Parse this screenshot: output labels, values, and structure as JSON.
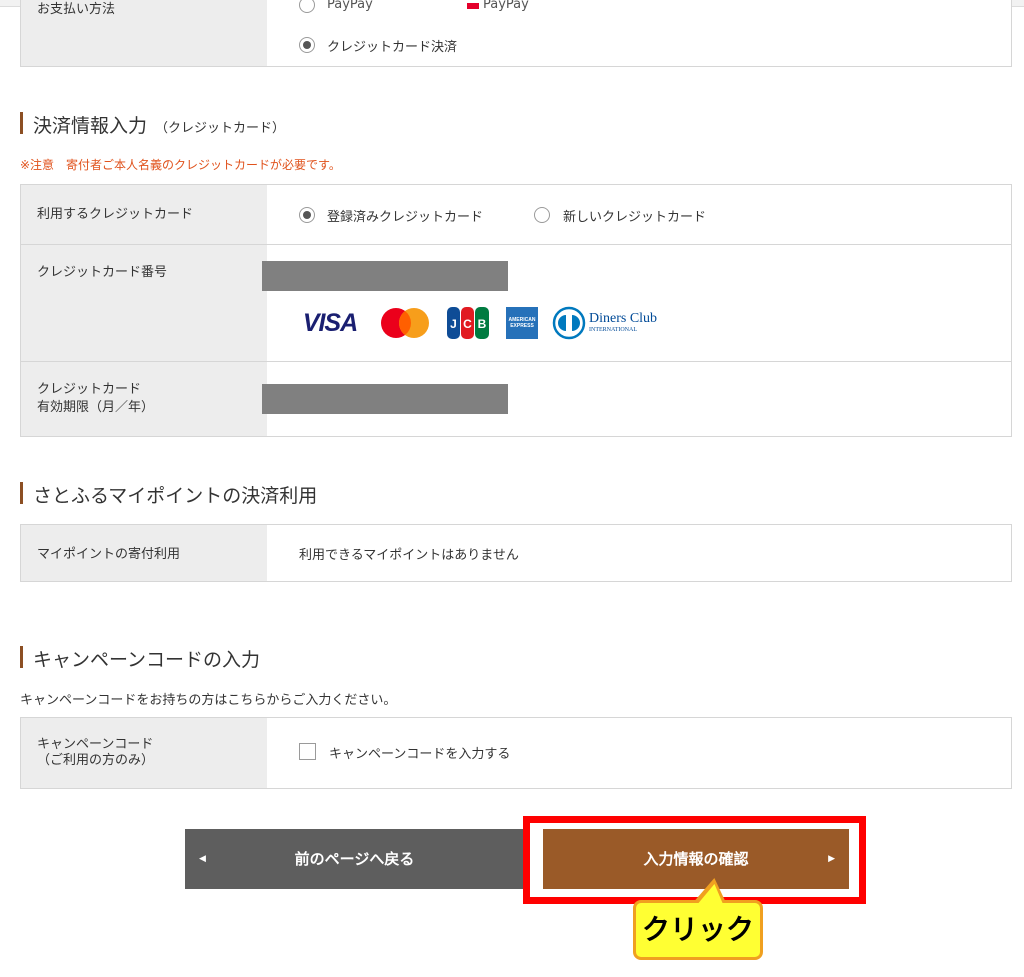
{
  "payment_method": {
    "label": "お支払い方法",
    "cut_options": [
      "PayPay",
      "PayPay"
    ],
    "credit_option": "クレジットカード決済"
  },
  "card_section": {
    "title": "決済情報入力",
    "subtitle": "（クレジットカード）",
    "notice": "※注意　寄付者ご本人名義のクレジットカードが必要です。",
    "use_card_label": "利用するクレジットカード",
    "option_registered": "登録済みクレジットカード",
    "option_new": "新しいクレジットカード",
    "card_number_label": "クレジットカード番号",
    "expiry_label_line1": "クレジットカード",
    "expiry_label_line2": "有効期限（月／年）",
    "brands": {
      "visa": "VISA",
      "jcb": "JCB",
      "amex": "AMERICAN EXPRESS",
      "diners": "Diners Club",
      "diners_sub": "INTERNATIONAL"
    }
  },
  "points_section": {
    "title": "さとふるマイポイントの決済利用",
    "label": "マイポイントの寄付利用",
    "value": "利用できるマイポイントはありません"
  },
  "campaign_section": {
    "title": "キャンペーンコードの入力",
    "description": "キャンペーンコードをお持ちの方はこちらからご入力ください。",
    "label_line1": "キャンペーンコード",
    "label_line2": "（ご利用の方のみ）",
    "checkbox_label": "キャンペーンコードを入力する"
  },
  "buttons": {
    "back": "前のページへ戻る",
    "confirm": "入力情報の確認",
    "back_arrow": "◀",
    "confirm_arrow": "▶"
  },
  "annotation": {
    "callout": "クリック"
  },
  "colors": {
    "brand_brown": "#8c4f23",
    "notice_orange": "#e0521c",
    "back_gray": "#5e5e5e",
    "highlight_red": "#ff0000",
    "callout_yellow": "#ffff33"
  }
}
